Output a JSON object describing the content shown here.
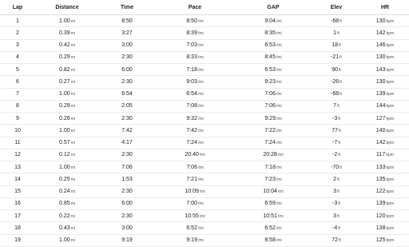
{
  "table": {
    "headers": [
      "Lap",
      "Distance",
      "Time",
      "Pace",
      "GAP",
      "Elev",
      "HR"
    ],
    "units": {
      "distance": "mi",
      "pace": "/mi",
      "gap": "/mi",
      "elev": "ft",
      "hr": "bpm"
    },
    "rows": [
      {
        "lap": "1",
        "distance": "1.00",
        "time": "8:50",
        "pace": "8:50",
        "gap": "9:04",
        "elev": "-68",
        "hr": "130"
      },
      {
        "lap": "2",
        "distance": "0.39",
        "time": "3:27",
        "pace": "8:39",
        "gap": "8:35",
        "elev": "1",
        "hr": "142"
      },
      {
        "lap": "3",
        "distance": "0.42",
        "time": "3:00",
        "pace": "7:03",
        "gap": "6:53",
        "elev": "18",
        "hr": "146"
      },
      {
        "lap": "4",
        "distance": "0.29",
        "time": "2:30",
        "pace": "8:33",
        "gap": "8:45",
        "elev": "-21",
        "hr": "130"
      },
      {
        "lap": "5",
        "distance": "0.82",
        "time": "6:00",
        "pace": "7:18",
        "gap": "6:53",
        "elev": "90",
        "hr": "143"
      },
      {
        "lap": "6",
        "distance": "0.27",
        "time": "2:30",
        "pace": "9:03",
        "gap": "9:23",
        "elev": "-26",
        "hr": "130"
      },
      {
        "lap": "7",
        "distance": "1.00",
        "time": "6:54",
        "pace": "6:54",
        "gap": "7:06",
        "elev": "-68",
        "hr": "139"
      },
      {
        "lap": "8",
        "distance": "0.29",
        "time": "2:05",
        "pace": "7:08",
        "gap": "7:06",
        "elev": "7",
        "hr": "144"
      },
      {
        "lap": "9",
        "distance": "0.26",
        "time": "2:30",
        "pace": "9:32",
        "gap": "9:29",
        "elev": "-3",
        "hr": "127"
      },
      {
        "lap": "10",
        "distance": "1.00",
        "time": "7:42",
        "pace": "7:42",
        "gap": "7:22",
        "elev": "77",
        "hr": "140"
      },
      {
        "lap": "11",
        "distance": "0.57",
        "time": "4:17",
        "pace": "7:24",
        "gap": "7:24",
        "elev": "-7",
        "hr": "142"
      },
      {
        "lap": "12",
        "distance": "0.12",
        "time": "2:30",
        "pace": "20:40",
        "gap": "20:28",
        "elev": "-2",
        "hr": "117"
      },
      {
        "lap": "13",
        "distance": "1.00",
        "time": "7:06",
        "pace": "7:06",
        "gap": "7:18",
        "elev": "-70",
        "hr": "133"
      },
      {
        "lap": "14",
        "distance": "0.25",
        "time": "1:53",
        "pace": "7:21",
        "gap": "7:23",
        "elev": "2",
        "hr": "135"
      },
      {
        "lap": "15",
        "distance": "0.24",
        "time": "2:30",
        "pace": "10:09",
        "gap": "10:04",
        "elev": "3",
        "hr": "122"
      },
      {
        "lap": "16",
        "distance": "0.85",
        "time": "6:00",
        "pace": "7:00",
        "gap": "6:59",
        "elev": "-3",
        "hr": "139"
      },
      {
        "lap": "17",
        "distance": "0.22",
        "time": "2:30",
        "pace": "10:55",
        "gap": "10:51",
        "elev": "3",
        "hr": "120"
      },
      {
        "lap": "18",
        "distance": "0.43",
        "time": "3:00",
        "pace": "6:52",
        "gap": "6:52",
        "elev": "-4",
        "hr": "138"
      },
      {
        "lap": "19",
        "distance": "1.00",
        "time": "9:19",
        "pace": "9:19",
        "gap": "8:58",
        "elev": "72",
        "hr": "125"
      }
    ]
  }
}
